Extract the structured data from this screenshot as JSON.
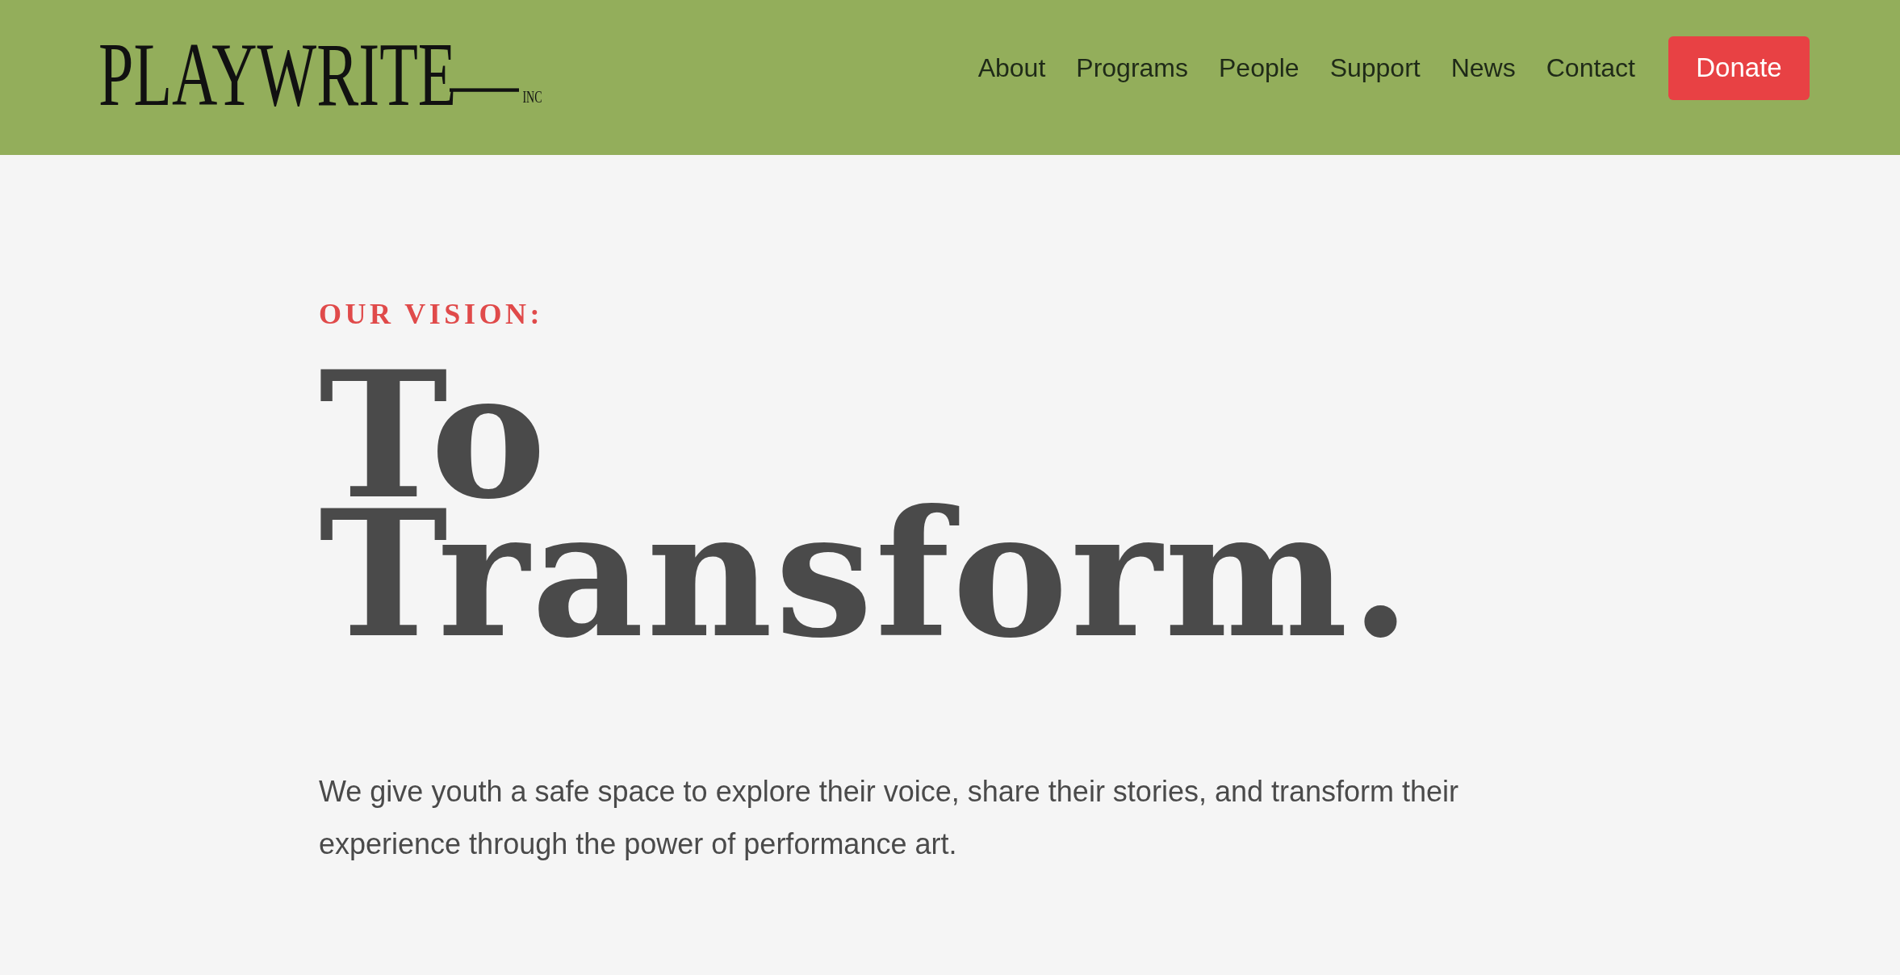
{
  "header": {
    "logo": {
      "wordmark": "PLAYWRITE",
      "suffix": "INC"
    },
    "nav": [
      "About",
      "Programs",
      "People",
      "Support",
      "News",
      "Contact"
    ],
    "donate_button": "Donate"
  },
  "hero": {
    "eyebrow": "OUR VISION:",
    "heading": "To Transform.",
    "body": "We give youth a safe space to explore their voice, share their stories, and transform their experience through the power of performance art."
  }
}
